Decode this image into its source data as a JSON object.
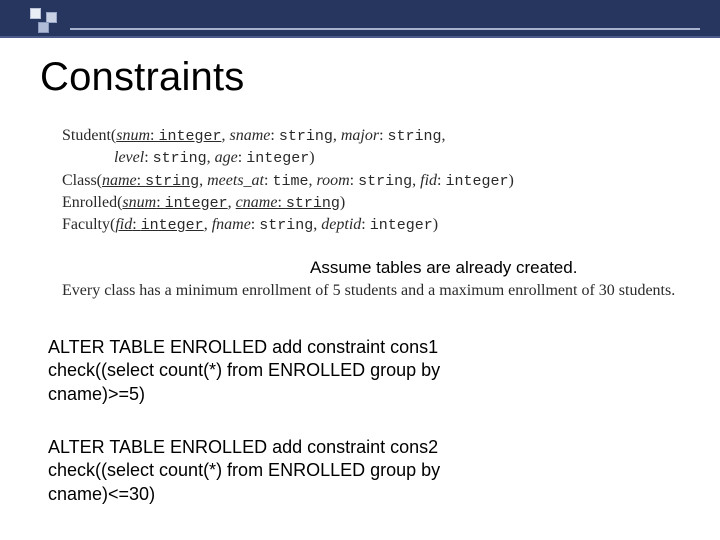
{
  "title": "Constraints",
  "schema": {
    "student": {
      "name": "Student",
      "line1_after_name": "(",
      "attrs_l1": [
        {
          "k": "snum",
          "t": "integer",
          "ul": true
        },
        {
          "k": "sname",
          "t": "string"
        },
        {
          "k": "major",
          "t": "string"
        }
      ],
      "l1_trail": ",",
      "attrs_l2": [
        {
          "k": "level",
          "t": "string"
        },
        {
          "k": "age",
          "t": "integer"
        }
      ],
      "l2_close": ")"
    },
    "class": {
      "name": "Class",
      "attrs": [
        {
          "k": "name",
          "t": "string",
          "ul": true
        },
        {
          "k": "meets_at",
          "t": "time"
        },
        {
          "k": "room",
          "t": "string"
        },
        {
          "k": "fid",
          "t": "integer"
        }
      ]
    },
    "enrolled": {
      "name": "Enrolled",
      "attrs": [
        {
          "k": "snum",
          "t": "integer",
          "ul": true
        },
        {
          "k": "cname",
          "t": "string",
          "ul": true
        }
      ]
    },
    "faculty": {
      "name": "Faculty",
      "attrs": [
        {
          "k": "fid",
          "t": "integer",
          "ul": true
        },
        {
          "k": "fname",
          "t": "string"
        },
        {
          "k": "deptid",
          "t": "integer"
        }
      ]
    }
  },
  "assume_note": "Assume tables are already created.",
  "problem_text": "Every class has a minimum enrollment of 5 students and a maximum enrollment of 30 students.",
  "sql": {
    "block1": {
      "l1": "ALTER TABLE ENROLLED add constraint cons1",
      "l2": "check((select  count(*) from ENROLLED group by",
      "l3": "cname)>=5)"
    },
    "block2": {
      "l1": "ALTER TABLE ENROLLED add constraint cons2",
      "l2": "check((select  count(*) from ENROLLED group by",
      "l3": "cname)<=30)"
    }
  }
}
